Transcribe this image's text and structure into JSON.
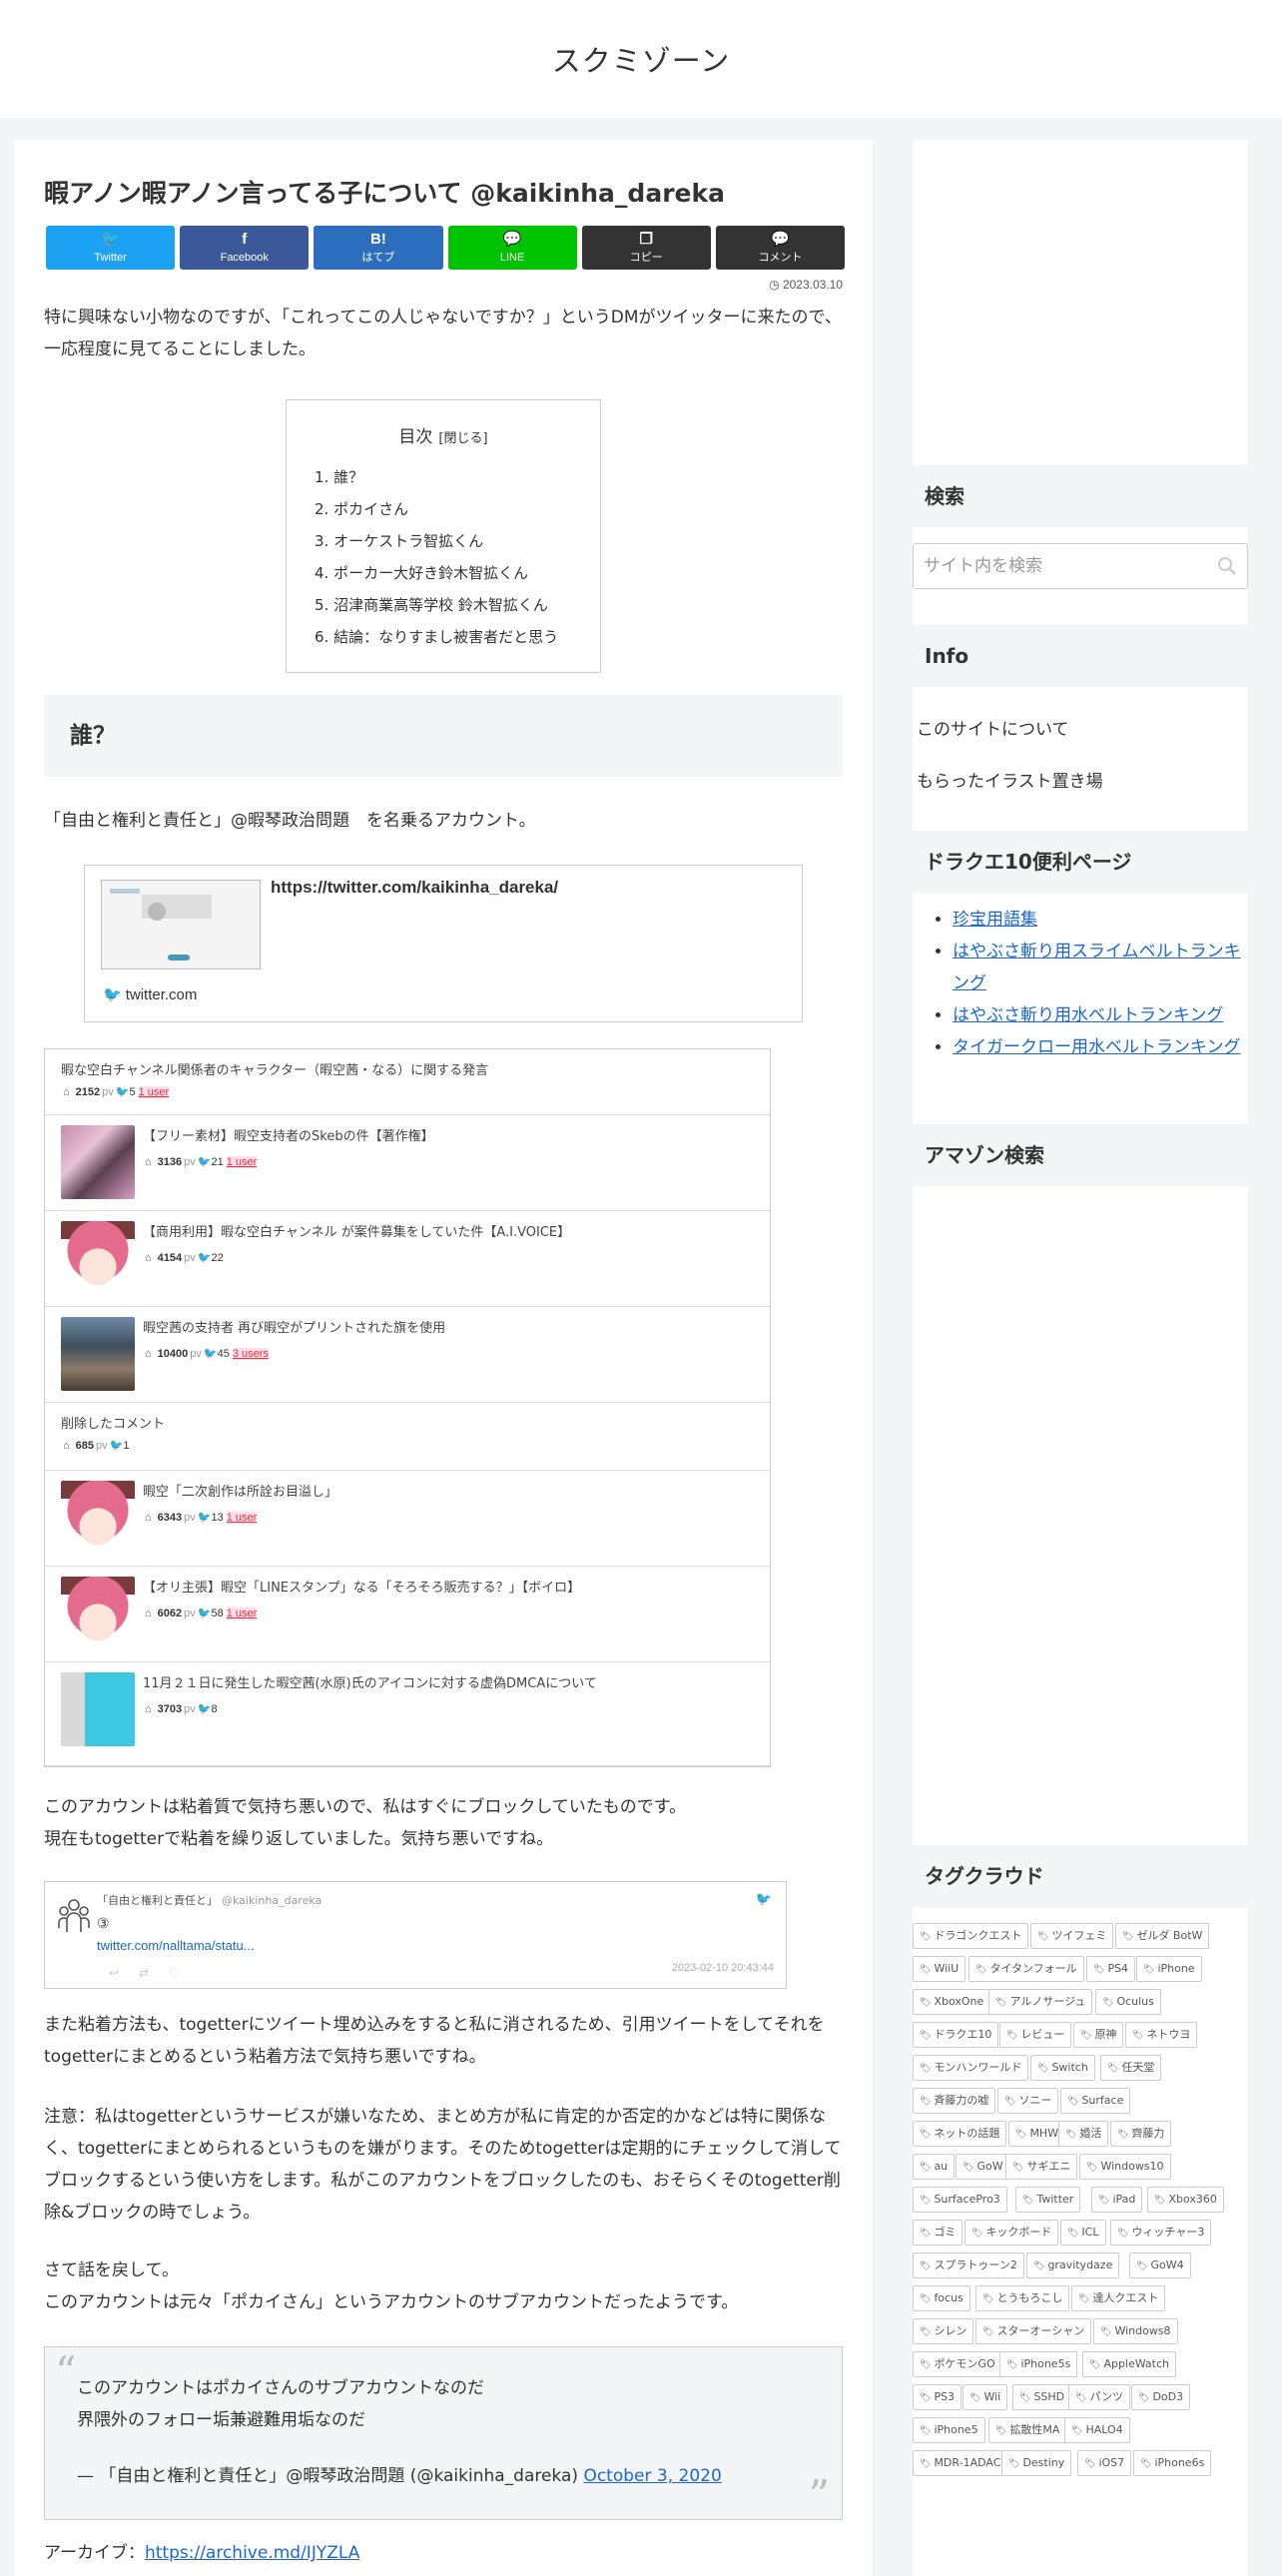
{
  "site": {
    "title": "スクミゾーン"
  },
  "article": {
    "title": "暇アノン暇アノン言ってる子について @kaikinha_dareka",
    "date": "2023.03.10",
    "sns": [
      {
        "icon": "🐦",
        "label": "Twitter",
        "color": "#1da1f2"
      },
      {
        "icon": "f",
        "label": "Facebook",
        "color": "#3b5998"
      },
      {
        "icon": "B!",
        "label": "はてブ",
        "color": "#2c6ebd"
      },
      {
        "icon": "💬",
        "label": "LINE",
        "color": "#00c300"
      },
      {
        "icon": "❐",
        "label": "コピー",
        "color": "#333333"
      },
      {
        "icon": "💬",
        "label": "コメント",
        "color": "#333333"
      }
    ],
    "intro": "特に興味ない小物なのですが、「これってこの人じゃないですか？」というDMがツイッターに来たので、一応程度に見てることにしました。",
    "toc": {
      "title": "目次",
      "toggle": "[閉じる]",
      "items": [
        "1. 誰？",
        "2. ポカイさん",
        "3. オーケストラ智拡くん",
        "4. ポーカー大好き鈴木智拡くん",
        "5. 沼津商業高等学校 鈴木智拡くん",
        "6. 結論：なりすまし被害者だと思う"
      ]
    },
    "h2": "誰？",
    "account_intro": "「自由と権利と責任と」@暇琴政治問題　を名乗るアカウント。",
    "blogcard": {
      "title": "https://twitter.com/kaikinha_dareka/",
      "site": "twitter.com"
    },
    "togetter": [
      {
        "title": "暇な空白チャンネル関係者のキャラクター（暇空茜・なる）に関する発言",
        "pv": "2152",
        "rt": "5",
        "users": "1 user",
        "thumb": ""
      },
      {
        "title": "【フリー素材】暇空支持者のSkebの件【著作権】",
        "pv": "3136",
        "rt": "21",
        "users": "1 user",
        "thumb": "anime"
      },
      {
        "title": "【商用利用】暇な空白チャンネル が案件募集をしていた件【A.I.VOICE】",
        "pv": "4154",
        "rt": "22",
        "users": "",
        "thumb": "char"
      },
      {
        "title": "暇空茜の支持者 再び暇空がプリントされた旗を使用",
        "pv": "10400",
        "rt": "45",
        "users": "3 users",
        "thumb": "photo"
      },
      {
        "title": "削除したコメント",
        "pv": "685",
        "rt": "1",
        "users": "",
        "thumb": ""
      },
      {
        "title": "暇空「二次創作は所詮お目溢し」",
        "pv": "6343",
        "rt": "13",
        "users": "1 user",
        "thumb": "char"
      },
      {
        "title": "【オリ主張】暇空「LINEスタンプ」なる「そろそろ販売する？」【ボイロ】",
        "pv": "6062",
        "rt": "58",
        "users": "1 user",
        "thumb": "char"
      },
      {
        "title": "11月２１日に発生した暇空茜(水原)氏のアイコンに対する虚偽DMCAについて",
        "pv": "3703",
        "rt": "8",
        "users": "",
        "thumb": "dmca"
      }
    ],
    "pv_label": "pv",
    "para2_l1": "このアカウントは粘着質で気持ち悪いので、私はすぐにブロックしていたものです。",
    "para2_l2": "現在もtogetterで粘着を繰り返していました。気持ち悪いですね。",
    "tweetcard": {
      "name": "「自由と権利と責任と」",
      "handle": "@kaikinha_dareka",
      "body": "③",
      "link": "twitter.com/nalltama/statu...",
      "time": "2023-02-10 20:43:44"
    },
    "para3": "また粘着方法も、togetterにツイート埋め込みをすると私に消されるため、引用ツイートをしてそれをtogetterにまとめるという粘着方法で気持ち悪いですね。",
    "para4": "注意：私はtogetterというサービスが嫌いなため、まとめ方が私に肯定的か否定的かなどは特に関係なく、togetterにまとめられるというものを嫌がります。そのためtogetterは定期的にチェックして消してブロックするという使い方をします。私がこのアカウントをブロックしたのも、おそらくそのtogetter削除&ブロックの時でしょう。",
    "para5_l1": "さて話を戻して。",
    "para5_l2": "このアカウントは元々「ポカイさん」というアカウントのサブアカウントだったようです。",
    "quote": {
      "l1": "このアカウントはポカイさんのサブアカウントなのだ",
      "l2": "界隈外のフォロー垢兼避難用垢なのだ",
      "cite": "— 「自由と権利と責任と」@暇琴政治問題 (@kaikinha_dareka)",
      "cite_date": "October 3, 2020"
    },
    "archive_label": "アーカイブ：",
    "archive_link": "https://archive.md/IJYZLA"
  },
  "sidebar": {
    "search_title": "検索",
    "search_placeholder": "サイト内を検索",
    "info_title": "Info",
    "info_links": [
      "このサイトについて",
      "もらったイラスト置き場"
    ],
    "dq_title": "ドラクエ10便利ページ",
    "dq_links": [
      "珍宝用語集",
      "はやぶさ斬り用スライムベルトランキング",
      "はやぶさ斬り用水ベルトランキング",
      "タイガークロー用水ベルトランキング"
    ],
    "amazon_title": "アマゾン検索",
    "tag_title": "タグクラウド",
    "tags": [
      [
        "ドラゴンクエスト",
        "ツイフェミ",
        "ゼルダ BotW"
      ],
      [
        "WiiU",
        "タイタンフォール",
        "PS4",
        "iPhone"
      ],
      [
        "XboxOne",
        "アルノサージュ",
        "Oculus"
      ],
      [
        "ドラクエ10",
        "レビュー",
        "原神",
        "ネトウヨ"
      ],
      [
        "モンハンワールド",
        "Switch",
        "任天堂"
      ],
      [
        "斉藤力の嘘",
        "ソニー",
        "Surface"
      ],
      [
        "ネットの話題",
        "MHW",
        "婚活",
        "齊藤力"
      ],
      [
        "au",
        "GoW",
        "サギエニ",
        "Windows10"
      ],
      [
        "SurfacePro3",
        "Twitter",
        "iPad",
        "Xbox360"
      ],
      [
        "ゴミ",
        "キックボード",
        "ICL",
        "ウィッチャー3"
      ],
      [
        "スプラトゥーン2",
        "gravitydaze",
        "GoW4"
      ],
      [
        "focus",
        "とうもろこし",
        "達人クエスト"
      ],
      [
        "シレン",
        "スターオーシャン",
        "Windows8"
      ],
      [
        "ポケモンGO",
        "iPhone5s",
        "AppleWatch"
      ],
      [
        "PS3",
        "Wii",
        "SSHD",
        "パンツ",
        "DoD3"
      ],
      [
        "iPhone5",
        "拡散性MA",
        "HALO4"
      ],
      [
        "MDR-1ADAC",
        "Destiny",
        "iOS7",
        "iPhone6s"
      ]
    ]
  }
}
